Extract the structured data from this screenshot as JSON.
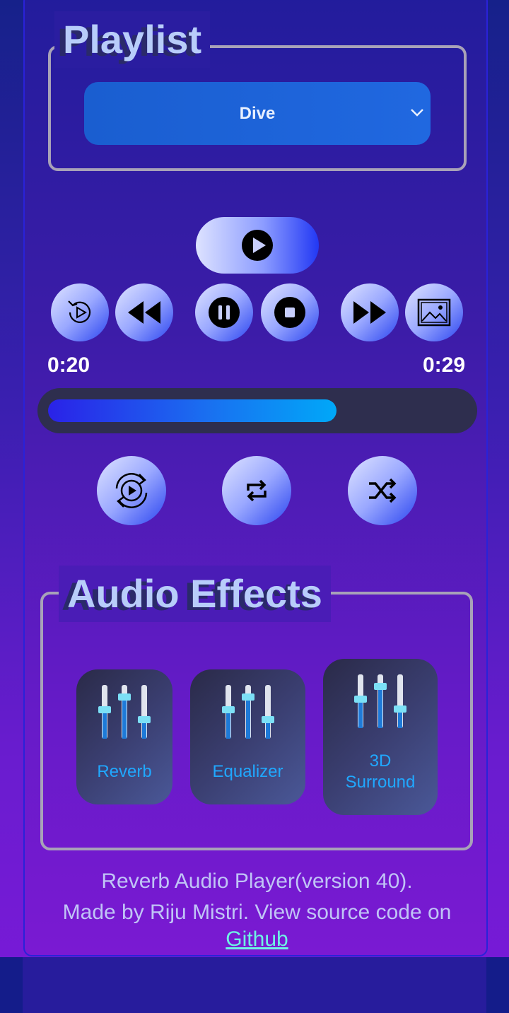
{
  "playlist": {
    "legend": "Playlist",
    "selected": "Dive"
  },
  "player": {
    "current_time": "0:20",
    "duration": "0:29",
    "progress_fraction": 0.69,
    "buttons": {
      "play": "play-icon",
      "replay": "replay-icon",
      "rewind": "rewind-icon",
      "pause": "pause-icon",
      "stop": "stop-icon",
      "fast_forward": "fast-forward-icon",
      "image": "image-icon",
      "autoplay": "autoplay-icon",
      "repeat": "repeat-icon",
      "shuffle": "shuffle-icon"
    }
  },
  "effects": {
    "legend": "Audio Effects",
    "items": [
      {
        "label": "Reverb"
      },
      {
        "label_line1": "Equalizer"
      },
      {
        "label_line1": "3D",
        "label_line2": "Surround"
      }
    ]
  },
  "footer": {
    "line1": "Reverb Audio Player(version 40).",
    "line2": "Made by Riju Mistri. View source code on",
    "link": "Github"
  },
  "colors": {
    "accent": "#2a44f0",
    "effect_text": "#20a8ff",
    "link": "#6ef4e4"
  }
}
